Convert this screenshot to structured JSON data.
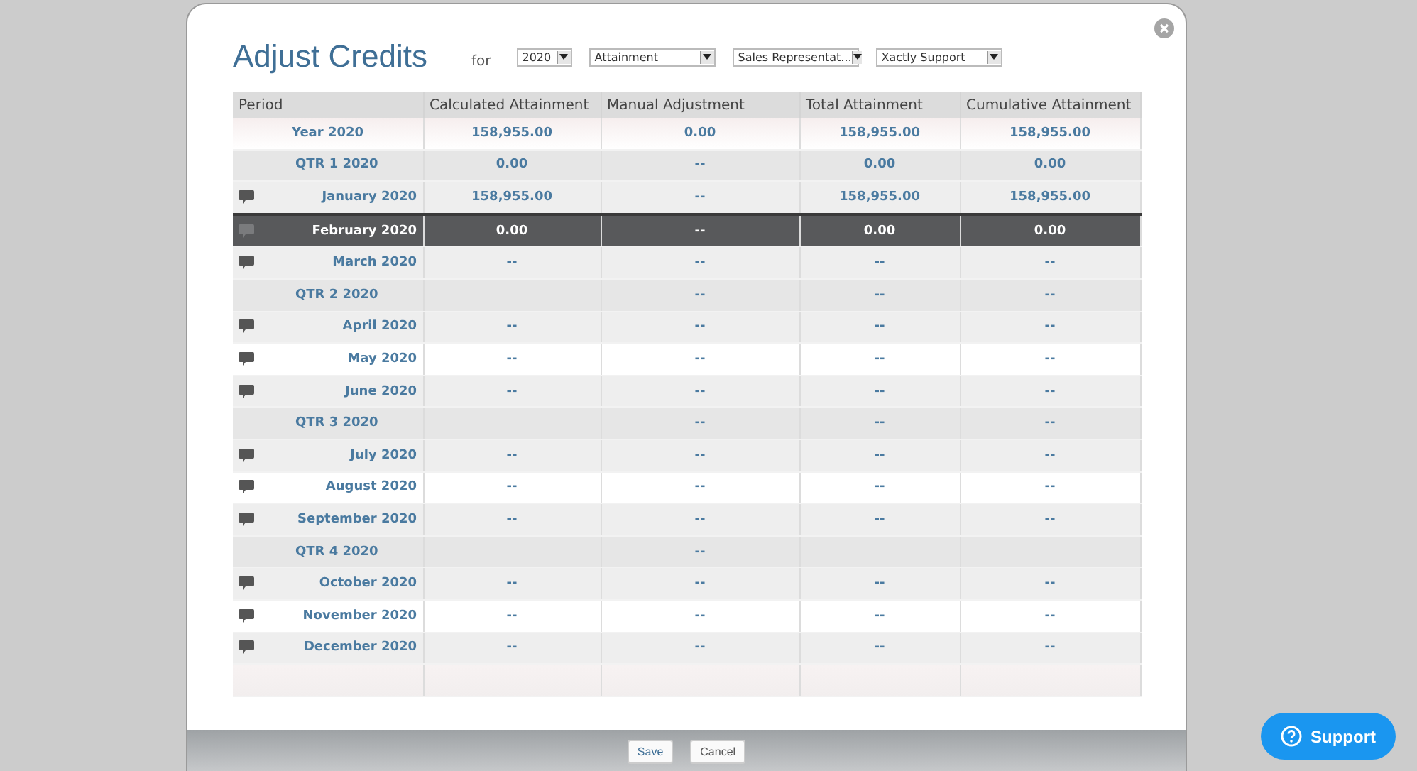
{
  "dialog": {
    "title": "Adjust Credits",
    "for_label": "for",
    "filters": [
      {
        "value": "2020"
      },
      {
        "value": "Attainment"
      },
      {
        "value": "Sales Representat..."
      },
      {
        "value": "Xactly Support"
      }
    ]
  },
  "table": {
    "columns": [
      "Period",
      "Calculated Attainment",
      "Manual Adjustment",
      "Total Attainment",
      "Cumulative Attainment"
    ],
    "rows": [
      {
        "kind": "year",
        "period": "Year 2020",
        "selected": false,
        "cells": [
          "158,955.00",
          "0.00",
          "158,955.00",
          "158,955.00"
        ]
      },
      {
        "kind": "quarter",
        "period": "QTR 1 2020",
        "selected": false,
        "cells": [
          "0.00",
          "--",
          "0.00",
          "0.00"
        ]
      },
      {
        "kind": "month",
        "period": "January 2020",
        "selected": false,
        "cells": [
          "158,955.00",
          "--",
          "158,955.00",
          "158,955.00"
        ]
      },
      {
        "kind": "month",
        "period": "February 2020",
        "selected": true,
        "cells": [
          "0.00",
          "--",
          "0.00",
          "0.00"
        ]
      },
      {
        "kind": "month",
        "period": "March 2020",
        "selected": false,
        "cells": [
          "--",
          "--",
          "--",
          "--"
        ]
      },
      {
        "kind": "quarter",
        "period": "QTR 2 2020",
        "selected": false,
        "cells": [
          null,
          "--",
          "--",
          "--"
        ]
      },
      {
        "kind": "month",
        "period": "April 2020",
        "selected": false,
        "cells": [
          "--",
          "--",
          "--",
          "--"
        ]
      },
      {
        "kind": "month",
        "period": "May 2020",
        "selected": false,
        "cells": [
          "--",
          "--",
          "--",
          "--"
        ]
      },
      {
        "kind": "month",
        "period": "June 2020",
        "selected": false,
        "cells": [
          "--",
          "--",
          "--",
          "--"
        ]
      },
      {
        "kind": "quarter",
        "period": "QTR 3 2020",
        "selected": false,
        "cells": [
          null,
          "--",
          "--",
          "--"
        ]
      },
      {
        "kind": "month",
        "period": "July 2020",
        "selected": false,
        "cells": [
          "--",
          "--",
          "--",
          "--"
        ]
      },
      {
        "kind": "month",
        "period": "August 2020",
        "selected": false,
        "cells": [
          "--",
          "--",
          "--",
          "--"
        ]
      },
      {
        "kind": "month",
        "period": "September 2020",
        "selected": false,
        "cells": [
          "--",
          "--",
          "--",
          "--"
        ]
      },
      {
        "kind": "quarter",
        "period": "QTR 4 2020",
        "selected": false,
        "cells": [
          null,
          "--",
          null,
          null
        ]
      },
      {
        "kind": "month",
        "period": "October 2020",
        "selected": false,
        "cells": [
          "--",
          "--",
          "--",
          "--"
        ]
      },
      {
        "kind": "month",
        "period": "November 2020",
        "selected": false,
        "cells": [
          "--",
          "--",
          "--",
          "--"
        ]
      },
      {
        "kind": "month",
        "period": "December 2020",
        "selected": false,
        "cells": [
          "--",
          "--",
          "--",
          "--"
        ]
      },
      {
        "kind": "blank",
        "selected": false
      }
    ]
  },
  "buttons": [
    {
      "label": "Save",
      "kind": "primary"
    },
    {
      "label": "Cancel",
      "kind": "secondary"
    }
  ],
  "support_button": {
    "label": "Support"
  }
}
